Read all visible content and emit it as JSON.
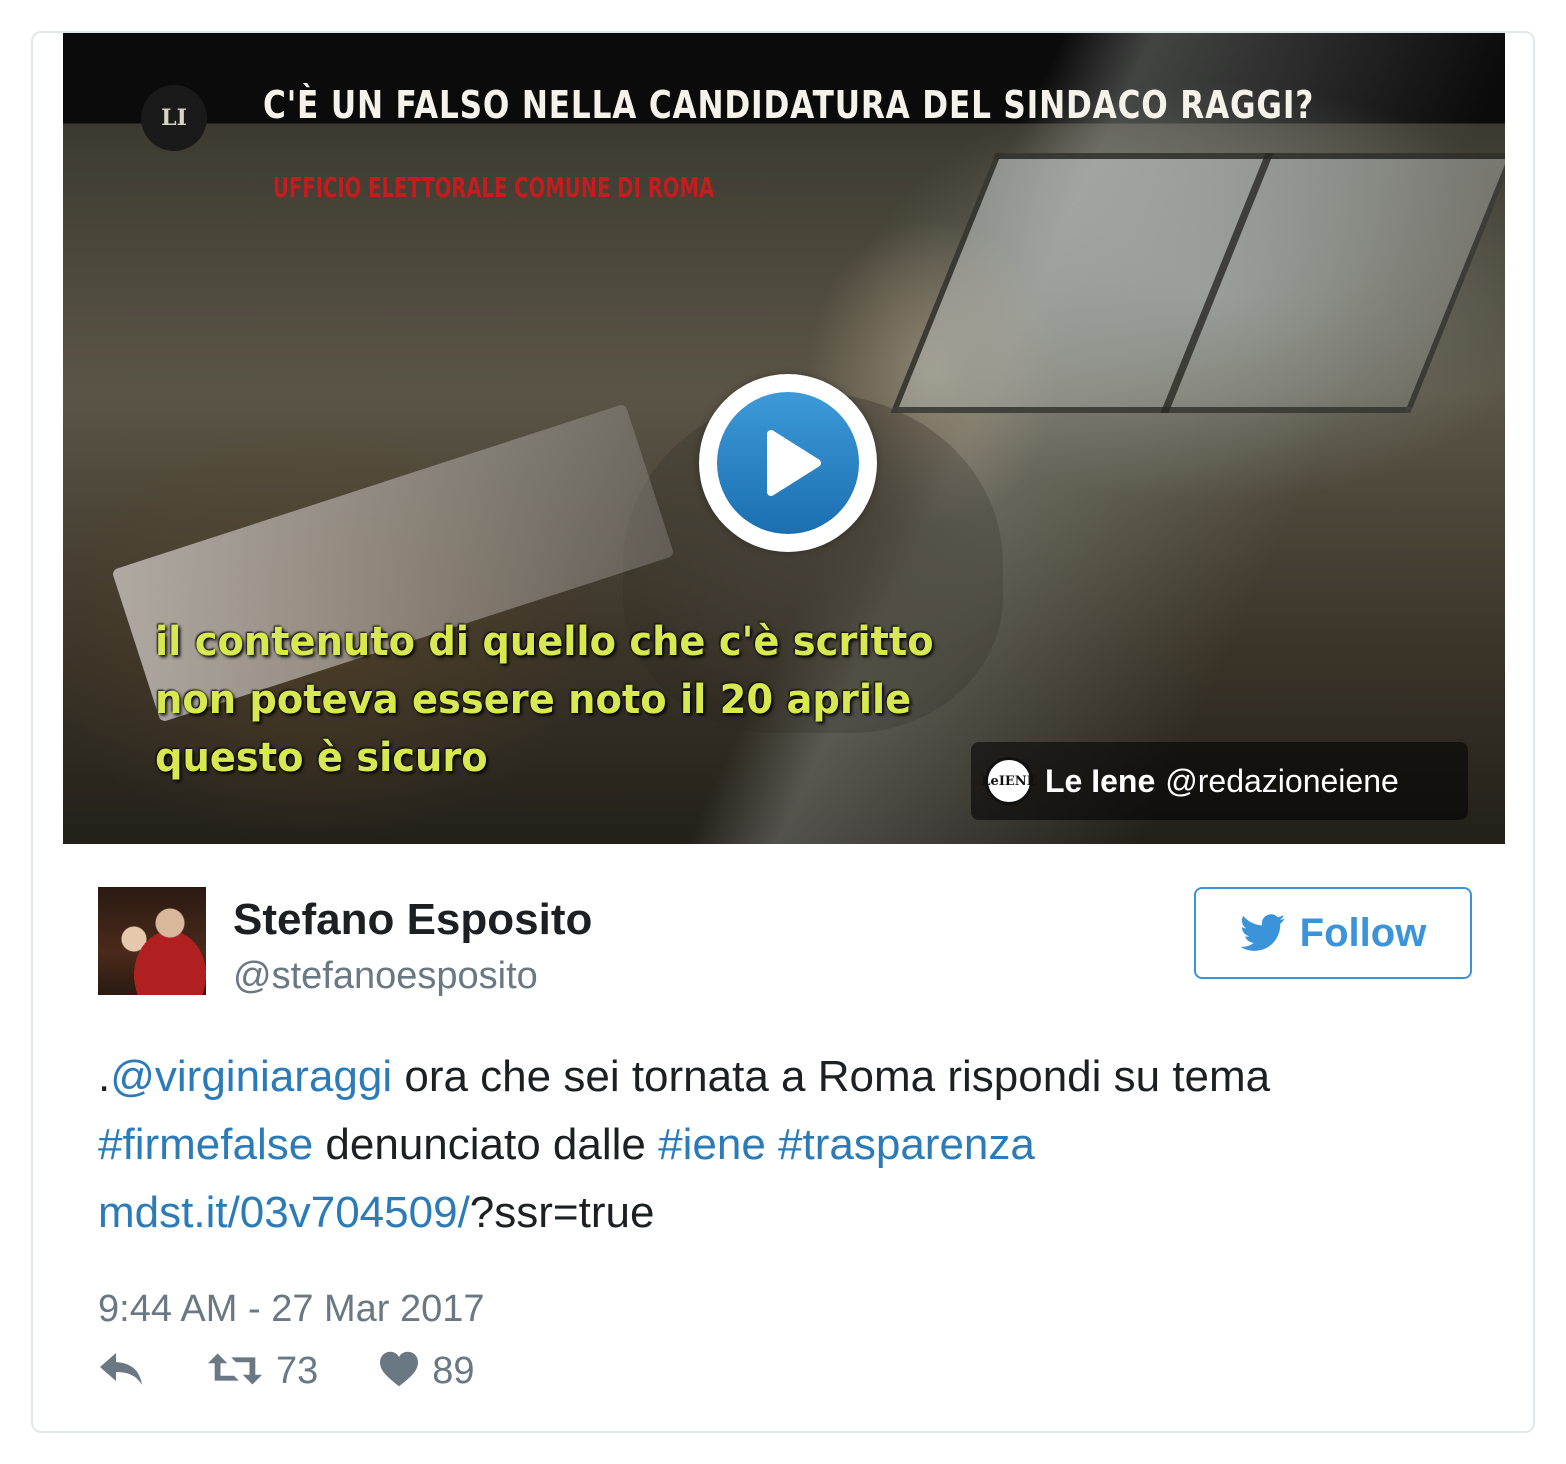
{
  "media": {
    "overlay_title": "C'È UN FALSO NELLA CANDIDATURA DEL SINDACO RAGGI?",
    "overlay_subtitle": "UFFICIO ELETTORALE COMUNE DI ROMA",
    "overlay_quote_lines": [
      "il contenuto di quello che c'è scritto",
      "non poteva essere noto il 20 aprile",
      "questo è sicuro"
    ],
    "attribution": {
      "name": "Le Iene",
      "handle": "@redazioneiene"
    },
    "play_icon": "play-icon"
  },
  "author": {
    "name": "Stefano Esposito",
    "handle": "@stefanoesposito",
    "avatar_icon": "avatar-photo"
  },
  "follow": {
    "label": "Follow",
    "icon": "twitter-bird-icon",
    "color": "#3b94d9"
  },
  "tweet": {
    "prefix": ".",
    "mention": "@virginiaraggi",
    "text1": " ora che sei tornata a Roma rispondi su tema ",
    "hashtag1": "#firmefalse",
    "text2": " denunciato dalle ",
    "hashtag2": "#iene",
    "space": " ",
    "hashtag3": "#trasparenza",
    "link": "mdst.it/03v704509/",
    "link_suffix": "?ssr=true",
    "link_color": "#2b7bb9"
  },
  "timestamp": "9:44 AM - 27 Mar 2017",
  "actions": {
    "reply_icon": "reply-icon",
    "retweet_icon": "retweet-icon",
    "retweets": "73",
    "like_icon": "heart-icon",
    "likes": "89"
  }
}
